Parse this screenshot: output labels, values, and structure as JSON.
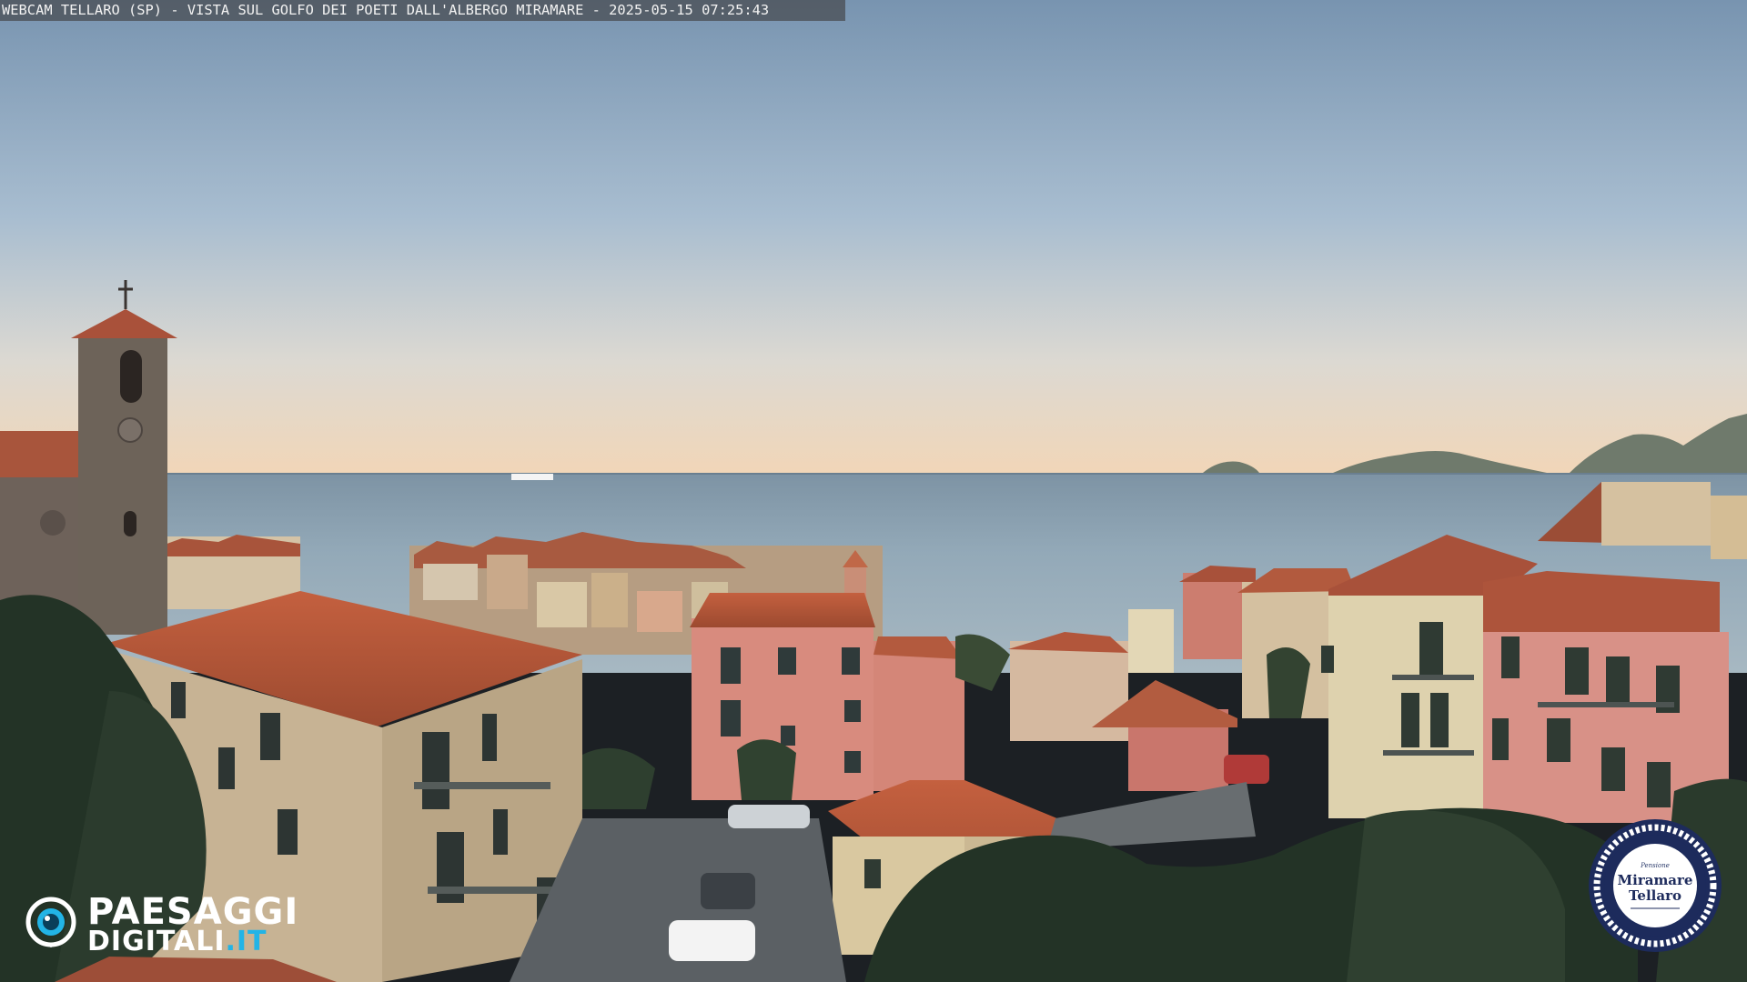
{
  "overlay": {
    "caption": "WEBCAM TELLARO (SP) - VISTA SUL GOLFO DEI POETI DALL'ALBERGO MIRAMARE - 2025-05-15 07:25:43"
  },
  "watermark": {
    "line1": "PAESAGGI",
    "line2": "DIGITALI",
    "line2_suffix": ".IT",
    "icon": "eye-icon",
    "accent_color": "#22b4e6"
  },
  "hotel_badge": {
    "small_text": "Pensione",
    "line1": "Miramare",
    "line2": "Tellaro",
    "ring_color": "#1d2b5c"
  },
  "colors": {
    "sky_top": "#7b98b4",
    "sky_horizon": "#f2d8b8",
    "sea": "#8fa6b4",
    "roof": "#b85a3c",
    "wall_pink": "#d9857a",
    "wall_cream": "#d7c3a0"
  }
}
